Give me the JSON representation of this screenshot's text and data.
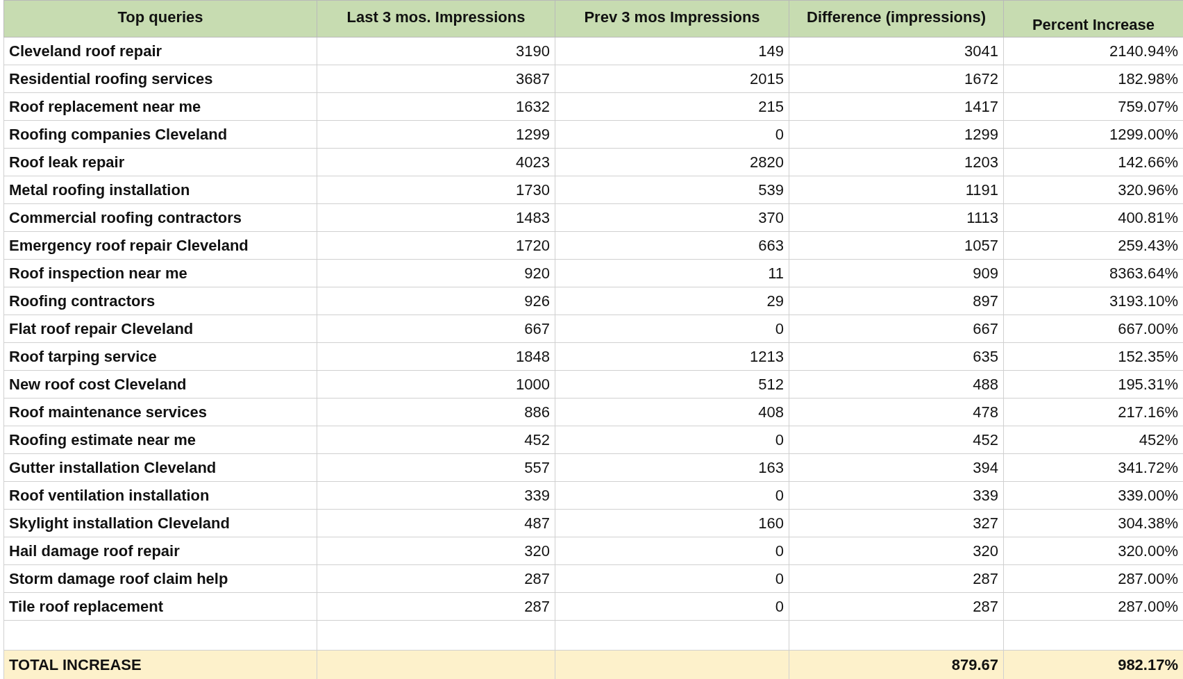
{
  "table": {
    "columns": [
      "Top queries",
      "Last 3 mos. Impressions",
      "Prev 3 mos Impressions",
      "Difference (impressions)",
      "Percent Increase"
    ],
    "rows": [
      [
        "Cleveland roof repair",
        "3190",
        "149",
        "3041",
        "2140.94%"
      ],
      [
        "Residential roofing services",
        "3687",
        "2015",
        "1672",
        "182.98%"
      ],
      [
        "Roof replacement near me",
        "1632",
        "215",
        "1417",
        "759.07%"
      ],
      [
        "Roofing companies Cleveland",
        "1299",
        "0",
        "1299",
        "1299.00%"
      ],
      [
        "Roof leak repair",
        "4023",
        "2820",
        "1203",
        "142.66%"
      ],
      [
        "Metal roofing installation",
        "1730",
        "539",
        "1191",
        "320.96%"
      ],
      [
        "Commercial roofing contractors",
        "1483",
        "370",
        "1113",
        "400.81%"
      ],
      [
        "Emergency roof repair Cleveland",
        "1720",
        "663",
        "1057",
        "259.43%"
      ],
      [
        "Roof inspection near me",
        "920",
        "11",
        "909",
        "8363.64%"
      ],
      [
        "Roofing contractors",
        "926",
        "29",
        "897",
        "3193.10%"
      ],
      [
        "Flat roof repair Cleveland",
        "667",
        "0",
        "667",
        "667.00%"
      ],
      [
        "Roof tarping service",
        "1848",
        "1213",
        "635",
        "152.35%"
      ],
      [
        "New roof cost Cleveland",
        "1000",
        "512",
        "488",
        "195.31%"
      ],
      [
        "Roof maintenance services",
        "886",
        "408",
        "478",
        "217.16%"
      ],
      [
        "Roofing estimate near me",
        "452",
        "0",
        "452",
        "452%"
      ],
      [
        "Gutter installation Cleveland",
        "557",
        "163",
        "394",
        "341.72%"
      ],
      [
        "Roof ventilation installation",
        "339",
        "0",
        "339",
        "339.00%"
      ],
      [
        "Skylight installation Cleveland",
        "487",
        "160",
        "327",
        "304.38%"
      ],
      [
        "Hail damage roof repair",
        "320",
        "0",
        "320",
        "320.00%"
      ],
      [
        "Storm damage roof claim help",
        "287",
        "0",
        "287",
        "287.00%"
      ],
      [
        "Tile roof replacement",
        "287",
        "0",
        "287",
        "287.00%"
      ]
    ],
    "total": {
      "label": "TOTAL INCREASE",
      "difference": "879.67",
      "percent": "982.17%"
    }
  }
}
